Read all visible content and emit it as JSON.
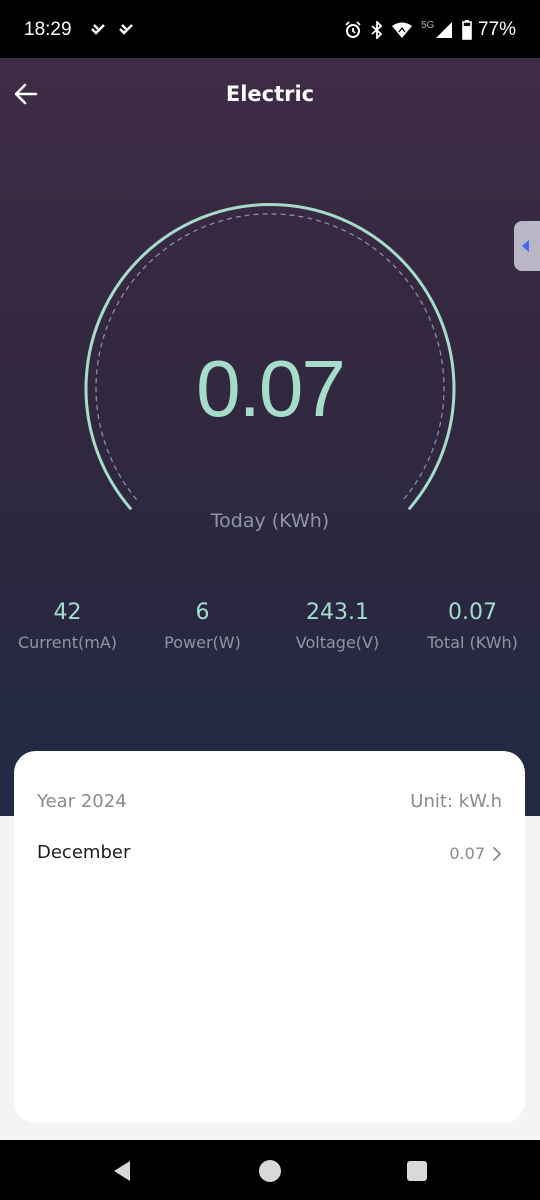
{
  "status_bar": {
    "time": "18:29",
    "battery_percent": "77%",
    "notification_icons": [
      "vpn-check-icon",
      "vpn-check-icon"
    ],
    "system_icons": [
      "alarm-icon",
      "bluetooth-icon",
      "wifi-icon",
      "5g-icon",
      "signal-icon",
      "battery-icon"
    ]
  },
  "header": {
    "title": "Electric",
    "back_icon": "arrow-left-icon"
  },
  "gauge": {
    "value": "0.07",
    "label": "Today (KWh)",
    "color": "#a6dcca"
  },
  "stats": [
    {
      "value": "42",
      "label": "Current(mA)"
    },
    {
      "value": "6",
      "label": "Power(W)"
    },
    {
      "value": "243.1",
      "label": "Voltage(V)"
    },
    {
      "value": "0.07",
      "label": "Total (KWh)"
    }
  ],
  "history": {
    "year_label": "Year 2024",
    "unit_label": "Unit: kW.h",
    "months": [
      {
        "name": "December",
        "value": "0.07"
      }
    ]
  },
  "side_tab_icon": "caret-left-icon",
  "nav_bar": {
    "buttons": [
      "back-triangle-icon",
      "home-circle-icon",
      "recents-square-icon"
    ]
  },
  "colors": {
    "accent": "#a6dcca",
    "muted_text": "#8d96a8",
    "side_tab_arrow": "#3f69ee"
  }
}
